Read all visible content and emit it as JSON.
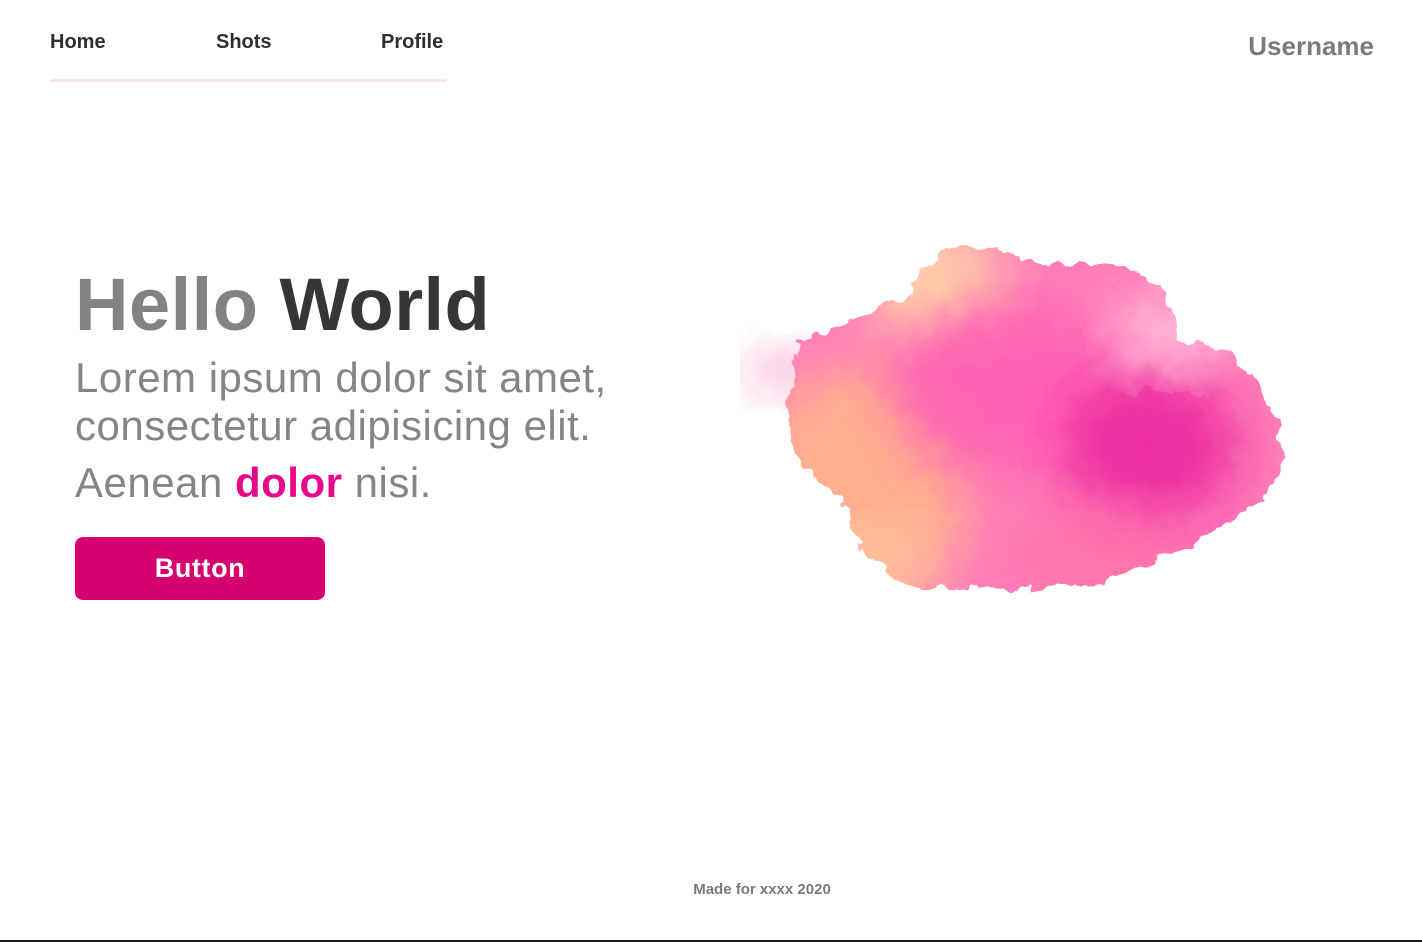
{
  "nav": {
    "items": [
      {
        "label": "Home"
      },
      {
        "label": "Shots"
      },
      {
        "label": "Profile"
      }
    ],
    "underline_color": "#fbe3ee"
  },
  "user": {
    "username": "Username"
  },
  "hero": {
    "title_part1": "Hello",
    "title_part2": "World",
    "subtitle": "Lorem ipsum dolor sit amet, consectetur adipisicing elit.",
    "line2_before": "Aenean",
    "line2_accent": "dolor",
    "line2_after": "nisi.",
    "accent_color": "#e8068a",
    "button_label": "Button",
    "button_color": "#d6006f"
  },
  "illustration": {
    "icon": "watercolor-blob-icon",
    "colors": [
      "#ff5fae",
      "#e8189a",
      "#ffb38a",
      "#ffe1a8"
    ]
  },
  "footer": {
    "text": "Made for xxxx 2020"
  }
}
